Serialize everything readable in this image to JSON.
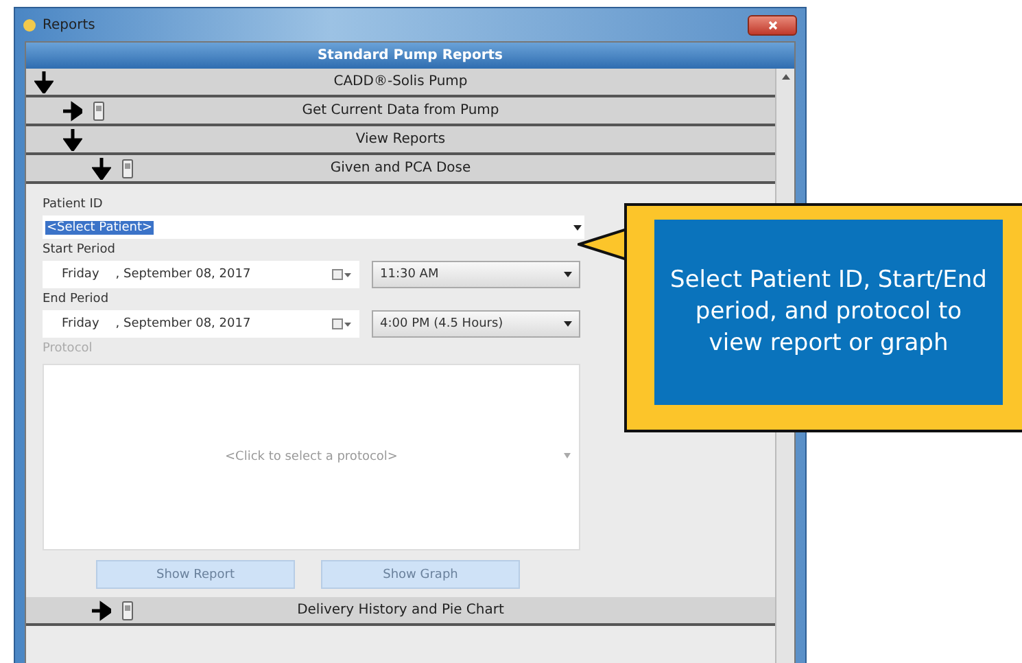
{
  "window": {
    "title": "Reports"
  },
  "header": "Standard Pump Reports",
  "tree": [
    {
      "label": "CADD®-Solis Pump",
      "kind": "group",
      "expanded": true,
      "children": [
        {
          "label": "Get Current Data from Pump",
          "kind": "device",
          "expanded": false
        },
        {
          "label": "View Reports",
          "kind": "group",
          "expanded": true,
          "children": [
            {
              "label": "Given and PCA Dose",
              "kind": "device",
              "expanded": true
            },
            {
              "label": "Delivery History and Pie Chart",
              "kind": "device",
              "expanded": false
            }
          ]
        }
      ]
    }
  ],
  "report_form": {
    "patient": {
      "label": "Patient ID",
      "value": "<Select Patient>",
      "selected": true
    },
    "start": {
      "label": "Start Period",
      "day": "Friday",
      "date": ", September 08, 2017",
      "time": "11:30 AM"
    },
    "end": {
      "label": "End Period",
      "day": "Friday",
      "date": ", September 08, 2017",
      "time": "4:00 PM (4.5 Hours)"
    },
    "protocol": {
      "label": "Protocol",
      "disabled": true,
      "placeholder": "<Click to select a protocol>"
    },
    "buttons": [
      {
        "label": "Show Report",
        "disabled": true
      },
      {
        "label": "Show Graph",
        "disabled": true
      }
    ]
  },
  "callout": "Select Patient ID, Start/End period, and protocol to view report or graph"
}
